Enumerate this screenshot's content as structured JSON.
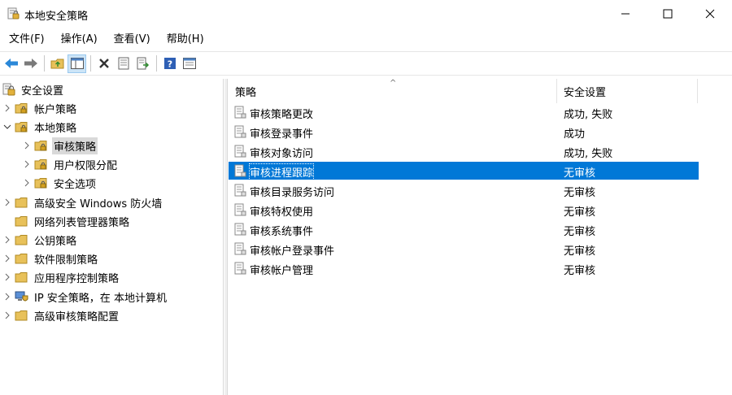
{
  "window": {
    "title": "本地安全策略",
    "icon": "local-security-policy-icon"
  },
  "menu": [
    "文件(F)",
    "操作(A)",
    "查看(V)",
    "帮助(H)"
  ],
  "toolbar": {
    "buttons": [
      "back-arrow-icon",
      "forward-arrow-icon",
      "up-folder-icon",
      "show-hide-tree-icon",
      "delete-icon",
      "properties-icon",
      "export-list-icon",
      "help-icon",
      "view-icon"
    ]
  },
  "tree": {
    "root": "安全设置",
    "items": [
      {
        "label": "帐户策略",
        "expanded": false
      },
      {
        "label": "本地策略",
        "expanded": true
      },
      {
        "label": "审核策略",
        "selected": true
      },
      {
        "label": "用户权限分配"
      },
      {
        "label": "安全选项"
      },
      {
        "label": "高级安全 Windows 防火墙"
      },
      {
        "label": "网络列表管理器策略"
      },
      {
        "label": "公钥策略"
      },
      {
        "label": "软件限制策略"
      },
      {
        "label": "应用程序控制策略"
      },
      {
        "label": "IP 安全策略，在 本地计算机"
      },
      {
        "label": "高级审核策略配置"
      }
    ]
  },
  "list": {
    "columns": [
      "策略",
      "安全设置"
    ],
    "sort_caret": "^",
    "rows": [
      {
        "policy": "审核策略更改",
        "setting": "成功, 失败"
      },
      {
        "policy": "审核登录事件",
        "setting": "成功"
      },
      {
        "policy": "审核对象访问",
        "setting": "成功, 失败"
      },
      {
        "policy": "审核进程跟踪",
        "setting": "无审核",
        "selected": true
      },
      {
        "policy": "审核目录服务访问",
        "setting": "无审核"
      },
      {
        "policy": "审核特权使用",
        "setting": "无审核"
      },
      {
        "policy": "审核系统事件",
        "setting": "无审核"
      },
      {
        "policy": "审核帐户登录事件",
        "setting": "无审核"
      },
      {
        "policy": "审核帐户管理",
        "setting": "无审核"
      }
    ]
  },
  "colors": {
    "selection": "#0078d7",
    "tree_selection": "#d9d9d9",
    "folder": "#e8c15a"
  }
}
